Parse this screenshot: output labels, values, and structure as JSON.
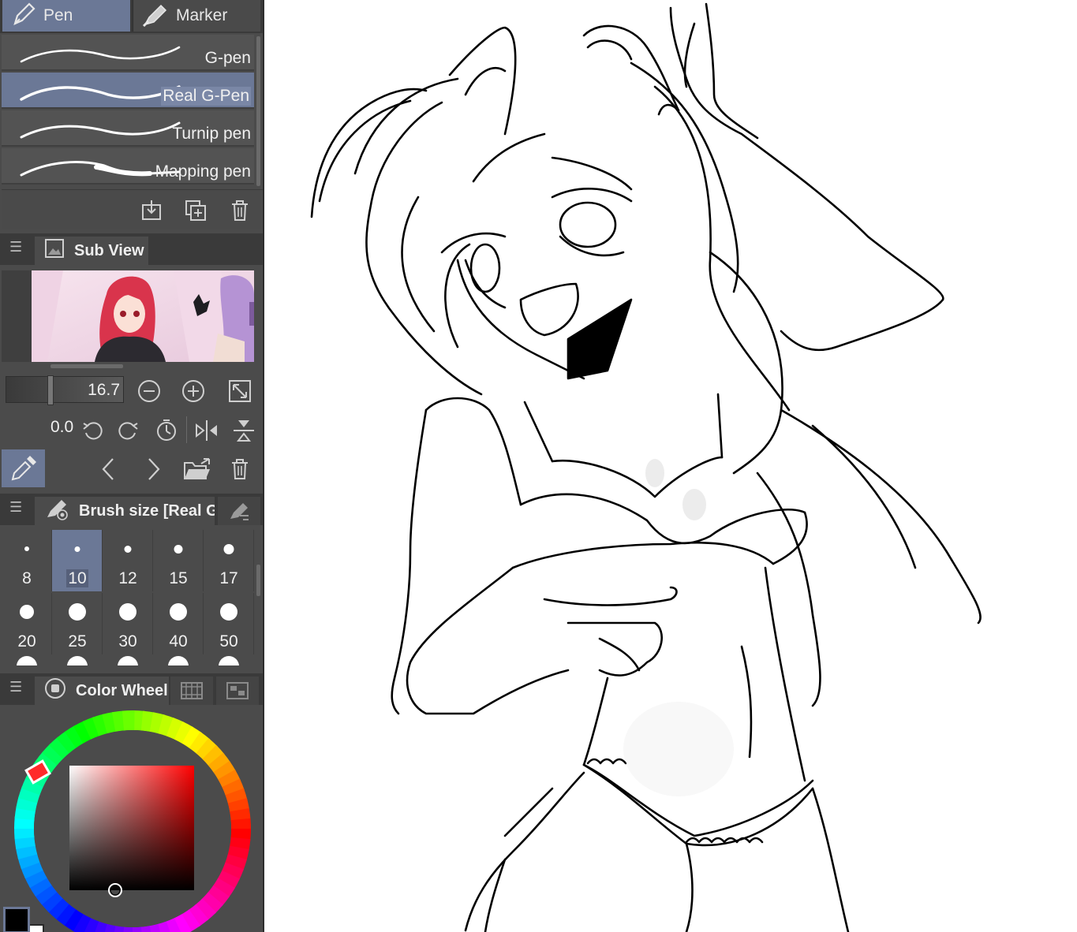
{
  "tool_tabs": [
    {
      "label": "Pen",
      "icon": "pen-icon",
      "active": true
    },
    {
      "label": "Marker",
      "icon": "marker-icon",
      "active": false
    }
  ],
  "brushes": [
    {
      "label": "G-pen",
      "selected": false
    },
    {
      "label": "Real G-Pen",
      "selected": true
    },
    {
      "label": "Turnip pen",
      "selected": false
    },
    {
      "label": "Mapping pen",
      "selected": false
    }
  ],
  "brush_toolbar": [
    "import-icon",
    "duplicate-icon",
    "trash-icon"
  ],
  "sub_view": {
    "title": "Sub View",
    "zoom_value": "16.7",
    "rotation_value": "0.0"
  },
  "brush_size": {
    "title": "Brush size [Real G-",
    "sizes": [
      "8",
      "10",
      "12",
      "15",
      "17",
      "20",
      "25",
      "30",
      "40",
      "50"
    ],
    "selected": "10"
  },
  "color_wheel": {
    "title": "Color Wheel",
    "hue": "#ff0000",
    "main_color": "#000000",
    "sub_color": "#ffffff"
  },
  "colors": {
    "panel_bg": "#4b4b4b",
    "panel_dark": "#3a3a3a",
    "accent": "#6b7896"
  }
}
